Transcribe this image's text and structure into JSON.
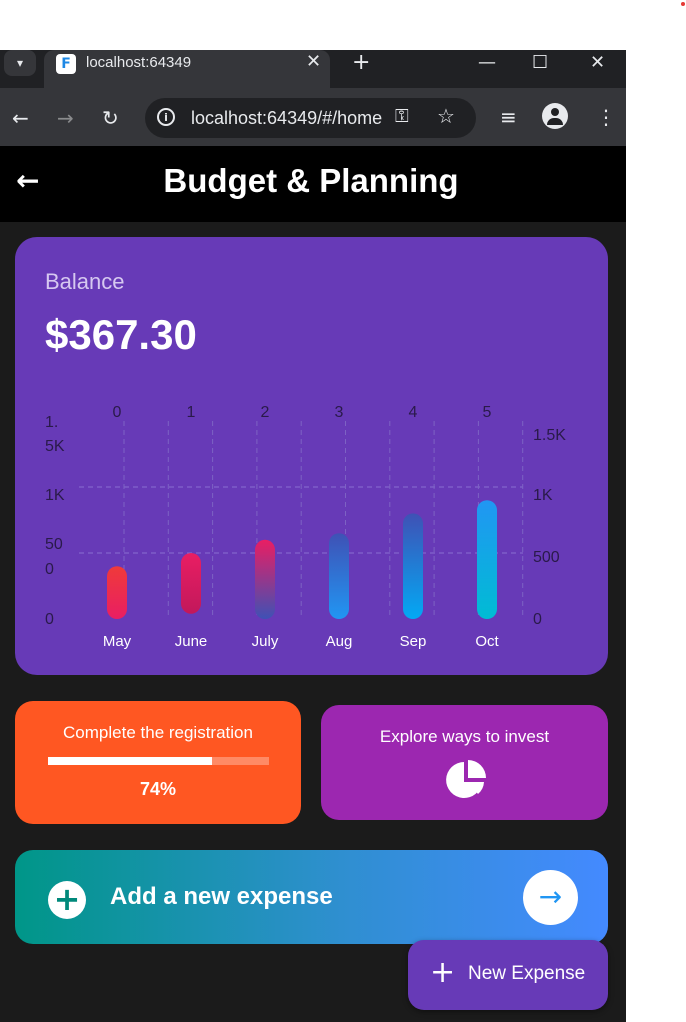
{
  "browser": {
    "tab_title": "localhost:64349",
    "favicon_letter": "F",
    "url": "localhost:64349/#/home",
    "new_tab_symbol": "+",
    "tab_close_symbol": "✕"
  },
  "app": {
    "title": "Budget & Planning",
    "back_symbol": "←"
  },
  "balance_card": {
    "label": "Balance",
    "amount": "$367.30"
  },
  "chart_data": {
    "type": "bar",
    "categories": [
      "May",
      "June",
      "July",
      "Aug",
      "Sep",
      "Oct"
    ],
    "top_ticks": [
      "0",
      "1",
      "2",
      "3",
      "4",
      "5"
    ],
    "left_ticks": [
      "1.\n5K",
      "1K",
      "50\n0",
      "0"
    ],
    "right_ticks": [
      "1.5K",
      "1K",
      "500",
      "0"
    ],
    "values": [
      {
        "low": 0,
        "high": 400
      },
      {
        "low": 40,
        "high": 500
      },
      {
        "low": 0,
        "high": 600
      },
      {
        "low": 0,
        "high": 650
      },
      {
        "low": 0,
        "high": 800
      },
      {
        "low": 0,
        "high": 900
      }
    ],
    "ylim": [
      0,
      1500
    ],
    "grid": true,
    "colors": {
      "gradient_top": [
        "#ef3a3a",
        "#e91e63",
        "#e91e63",
        "#3f51b5",
        "#3f51b5",
        "#2196f3"
      ],
      "gradient_bottom": [
        "#e91e63",
        "#c2185b",
        "#3f51b5",
        "#2196f3",
        "#03a9f4",
        "#00bcd4"
      ]
    }
  },
  "registration_card": {
    "title": "Complete the registration",
    "progress": 0.74,
    "progress_label": "74%"
  },
  "invest_card": {
    "title": "Explore ways to invest",
    "icon": "pie-chart-icon"
  },
  "expense_card": {
    "label": "Add a new expense",
    "plus_symbol": "+",
    "arrow_symbol": "→"
  },
  "fab": {
    "plus_symbol": "+",
    "label": "New Expense"
  },
  "colors": {
    "balance_bg": "#673ab7",
    "registration_bg": "#ff5722",
    "invest_bg": "#9c27b0",
    "fab_bg": "#673ab7"
  }
}
